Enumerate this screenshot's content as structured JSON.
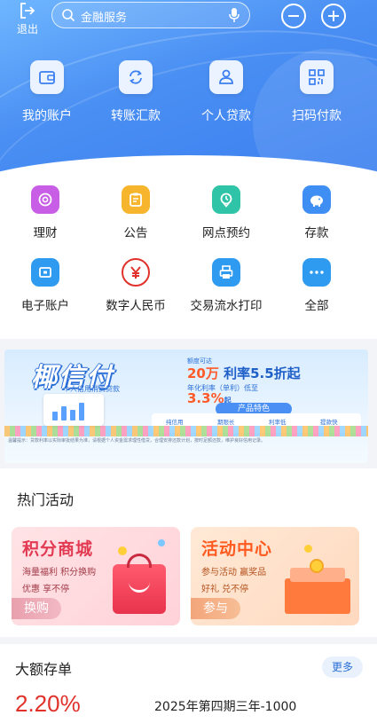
{
  "topbar": {
    "logout_label": "退出",
    "search_placeholder": "金融服务"
  },
  "quick_actions": [
    {
      "label": "我的账户",
      "icon": "wallet-icon"
    },
    {
      "label": "转账汇款",
      "icon": "transfer-icon"
    },
    {
      "label": "个人贷款",
      "icon": "person-loan-icon"
    },
    {
      "label": "扫码付款",
      "icon": "qr-scan-icon"
    }
  ],
  "services": [
    {
      "label": "理财",
      "icon": "wealth-icon",
      "color": "#c85ee6"
    },
    {
      "label": "公告",
      "icon": "notice-icon",
      "color": "#f7b52e"
    },
    {
      "label": "网点预约",
      "icon": "location-icon",
      "color": "#2fc4a8"
    },
    {
      "label": "存款",
      "icon": "piggy-bank-icon",
      "color": "#3f8ef3"
    },
    {
      "label": "电子账户",
      "icon": "e-account-icon",
      "color": "#2f9bf0"
    },
    {
      "label": "数字人民币",
      "icon": "digital-rmb-icon",
      "color": "#e0322a"
    },
    {
      "label": "交易流水打印",
      "icon": "printer-icon",
      "color": "#2f9bf0"
    },
    {
      "label": "全部",
      "icon": "more-dots-icon",
      "color": "#2f9bf0"
    }
  ],
  "banner": {
    "logo_text": "椰信付",
    "sub_text": "个人信用消费贷款",
    "line1": "额度可达",
    "amount": "20万",
    "rate_text": "利率5.5折起",
    "line3": "年化利率（单利）低至",
    "annual_rate": "3.3%",
    "annual_suffix": "起",
    "feature_title": "产品特色",
    "features": [
      "纯信用",
      "期限长",
      "利率低",
      "提款快"
    ],
    "fine_print": "温馨提示：贷款利率以实际审批结果为准，请根据个人资金需求理性借贷，合理安排还款计划，按时足额还款，维护良好信用记录。"
  },
  "hot": {
    "title": "热门活动",
    "cards": [
      {
        "title": "积分商城",
        "sub1": "海量福利 积分换购",
        "sub2": "优惠 享不停",
        "button": "换购"
      },
      {
        "title": "活动中心",
        "sub1": "参与活动 赢奖品",
        "sub2": "好礼 兑不停",
        "button": "参与"
      }
    ]
  },
  "deposit": {
    "title": "大额存单",
    "more_label": "更多",
    "rate": "2.20%",
    "product": "2025年第四期三年-1000"
  },
  "colors": {
    "primary": "#3b7ff0",
    "accent_red": "#e0322a"
  }
}
